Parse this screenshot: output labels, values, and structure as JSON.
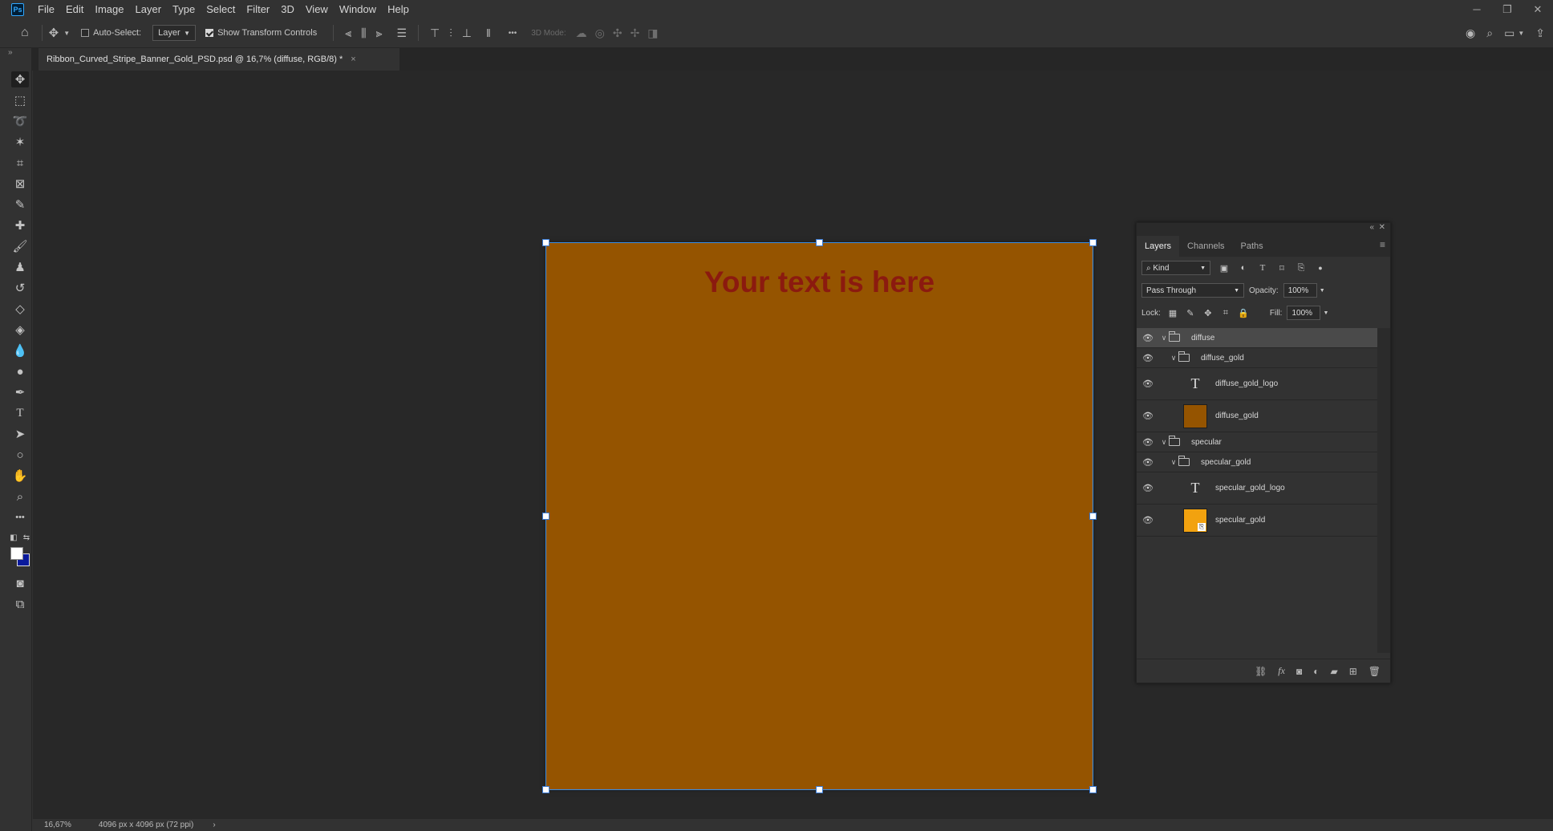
{
  "app": {
    "logo": "Ps"
  },
  "menu": [
    "File",
    "Edit",
    "Image",
    "Layer",
    "Type",
    "Select",
    "Filter",
    "3D",
    "View",
    "Window",
    "Help"
  ],
  "window_controls": {
    "minimize": "─",
    "restore": "❐",
    "close": "✕"
  },
  "options": {
    "auto_select_label": "Auto-Select:",
    "auto_select_checked": false,
    "layer_dropdown": "Layer",
    "show_transform_label": "Show Transform Controls",
    "show_transform_checked": true,
    "more": "•••",
    "mode_3d_label": "3D Mode:"
  },
  "document": {
    "tab_title": "Ribbon_Curved_Stripe_Banner_Gold_PSD.psd @ 16,7% (diffuse, RGB/8) *",
    "tab_close": "×",
    "canvas_text": "Your text is here",
    "canvas_color": "#955400",
    "text_color": "#8b1a0f"
  },
  "status": {
    "zoom": "16,67%",
    "info": "4096 px x 4096 px (72 ppi)",
    "arrow": "›"
  },
  "layers_panel": {
    "tabs": [
      "Layers",
      "Channels",
      "Paths"
    ],
    "active_tab": "Layers",
    "filter_kind": "Kind",
    "blend_mode": "Pass Through",
    "opacity_label": "Opacity:",
    "opacity": "100%",
    "lock_label": "Lock:",
    "fill_label": "Fill:",
    "fill": "100%",
    "layers": [
      {
        "name": "diffuse",
        "type": "group",
        "indent": 0,
        "selected": true
      },
      {
        "name": "diffuse_gold",
        "type": "group",
        "indent": 1,
        "selected": false
      },
      {
        "name": "diffuse_gold_logo",
        "type": "text",
        "indent": 2,
        "selected": false
      },
      {
        "name": "diffuse_gold",
        "type": "fill",
        "indent": 2,
        "selected": false,
        "thumb_color": "#955400"
      },
      {
        "name": "specular",
        "type": "group",
        "indent": 0,
        "selected": false
      },
      {
        "name": "specular_gold",
        "type": "group",
        "indent": 1,
        "selected": false
      },
      {
        "name": "specular_gold_logo",
        "type": "text",
        "indent": 2,
        "selected": false
      },
      {
        "name": "specular_gold",
        "type": "smart",
        "indent": 2,
        "selected": false,
        "thumb_color": "#f2a20f"
      }
    ]
  }
}
